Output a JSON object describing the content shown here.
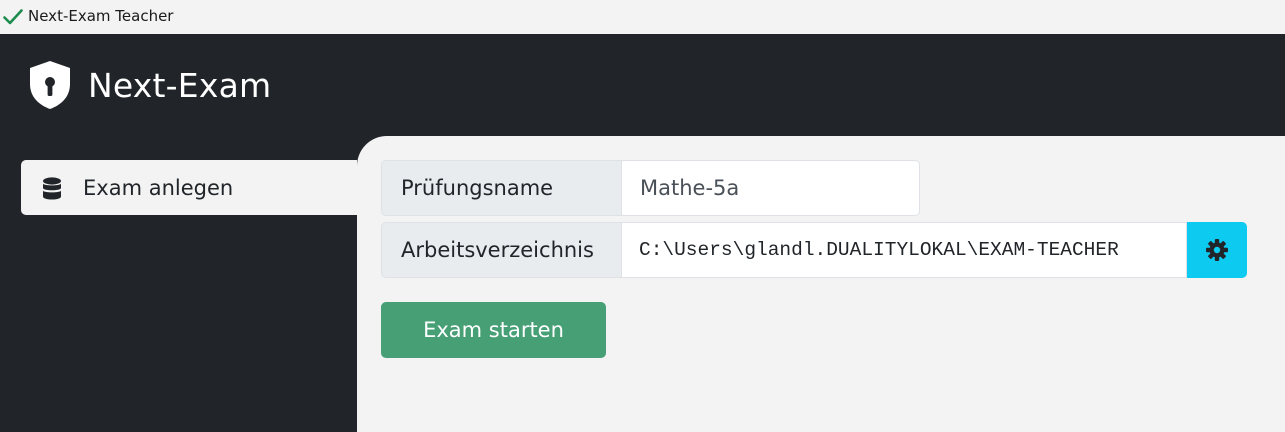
{
  "window": {
    "title": "Next-Exam Teacher",
    "status_icon": "checkmark-icon",
    "status_color": "#1e8c4e"
  },
  "header": {
    "brand": "Next-Exam",
    "logo_icon": "shield-lock-icon"
  },
  "sidebar": {
    "items": [
      {
        "label": "Exam anlegen",
        "icon": "database-icon",
        "active": true
      }
    ]
  },
  "form": {
    "exam_name": {
      "label": "Prüfungsname",
      "value": "Mathe-5a"
    },
    "workdir": {
      "label": "Arbeitsverzeichnis",
      "value": "C:\\Users\\glandl.DUALITYLOKAL\\EXAM-TEACHER",
      "button_icon": "gear-icon"
    },
    "start_button": "Exam starten"
  },
  "colors": {
    "dark": "#212529",
    "background": "#f3f3f3",
    "success": "#479f76",
    "info": "#0dcaf0"
  }
}
